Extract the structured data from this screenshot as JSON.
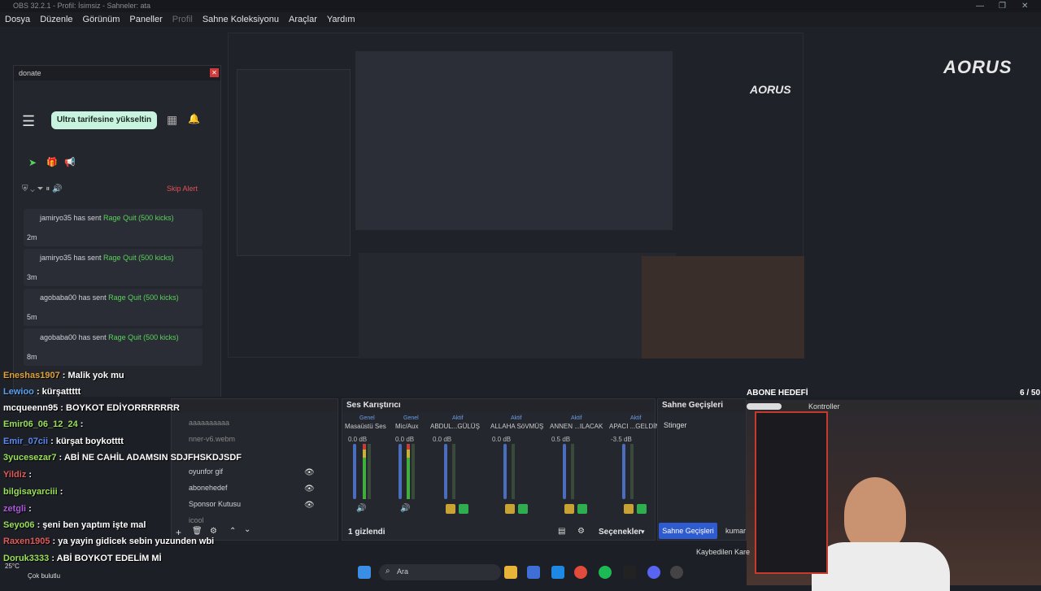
{
  "window": {
    "title": "OBS 32.2.1 - Profil: İsimsiz - Sahneler: ata"
  },
  "menu": [
    "Dosya",
    "Düzenle",
    "Görünüm",
    "Paneller",
    "Profil",
    "Sahne Koleksiyonu",
    "Araçlar",
    "Yardım"
  ],
  "donate": {
    "title": "donate",
    "upgrade": "Ultra tarifesine yükseltin",
    "skip": "Skip Alert",
    "alerts": [
      {
        "user": "jamiryo35",
        "text": " has sent ",
        "gift": "Rage Quit (500 kicks)",
        "ago": "2m"
      },
      {
        "user": "jamiryo35",
        "text": " has sent ",
        "gift": "Rage Quit (500 kicks)",
        "ago": "3m"
      },
      {
        "user": "agobaba00",
        "text": " has sent ",
        "gift": "Rage Quit (500 kicks)",
        "ago": "5m"
      },
      {
        "user": "agobaba00",
        "text": " has sent ",
        "gift": "Rage Quit (500 kicks)",
        "ago": "8m"
      }
    ]
  },
  "chat": [
    {
      "user": "Eneshas1907",
      "msg": " : Malik yok mu",
      "color": "#e0a23a"
    },
    {
      "user": "Lewioo",
      "msg": " : kürşattttt",
      "color": "#5aa0f0"
    },
    {
      "user": "mcqueenn95",
      "msg": " : BOYKOT EDİYORRRRRRR",
      "color": "#ffffff"
    },
    {
      "user": "Emir06_06_12_24",
      "msg": " :",
      "color": "#9adf5a"
    },
    {
      "user": "Emir_07cii",
      "msg": " : kürşat boykotttt",
      "color": "#5a8af0"
    },
    {
      "user": "3yucesezar7",
      "msg": " : ABİ NE CAHİL ADAMSIN SDJFHSKDJSDF",
      "color": "#9adf5a"
    },
    {
      "user": "Yildiz",
      "msg": " :",
      "color": "#e05a5a"
    },
    {
      "user": "bilgisayarciii",
      "msg": " :",
      "color": "#9adf5a"
    },
    {
      "user": "zetgli",
      "msg": " :",
      "color": "#b05ae0"
    },
    {
      "user": "Seyo06",
      "msg": " : şeni ben yaptım işte mal",
      "color": "#9adf5a"
    },
    {
      "user": "Raxen1905",
      "msg": " : ya yayin gidicek sebin yuzunden wbi",
      "color": "#e05a5a"
    },
    {
      "user": "Doruk3333",
      "msg": " : ABİ BOYKOT EDELİM Mİ",
      "color": "#9adf5a"
    }
  ],
  "sources": {
    "items": [
      "oyunfor gif",
      "abonehedef",
      "Sponsor Kutusu",
      "icool"
    ],
    "partial": [
      "aaaaaaaaaa",
      "nner-v6.webm"
    ]
  },
  "mixer": {
    "title": "Ses Karıştırıcı",
    "channels": [
      {
        "tag": "Genel",
        "name": "Masaüstü Ses",
        "db": "0.0 dB"
      },
      {
        "tag": "Genel",
        "name": "Mic/Aux",
        "db": "0.0 dB"
      },
      {
        "tag": "Aktif",
        "name": "ABDUL...GÜLÜŞ",
        "db": "0.0 dB"
      },
      {
        "tag": "Aktif",
        "name": "ALLAHA SöVMÜŞ",
        "db": "0.0 dB"
      },
      {
        "tag": "Aktif",
        "name": "ANNEN ...ILACAK",
        "db": "0.5 dB"
      },
      {
        "tag": "Aktif",
        "name": "APACI ...GELDİN",
        "db": "-3.5 dB"
      }
    ],
    "hidden": "1 gizlendi",
    "options": "Seçenekler"
  },
  "transitions": {
    "title": "Sahne Geçişleri",
    "value": "Stinger",
    "button": "Sahne Geçişleri",
    "partial": "kumar"
  },
  "overlay": {
    "goal_title": "ABONE HEDEFİ",
    "goal_count": "6 / 50",
    "goal_progress": 0.12,
    "controls": "Kontroller",
    "brand": "AORUS",
    "lost": "Kaybedilen Kare"
  },
  "taskbar": {
    "search": "Ara",
    "weather": "25°C",
    "weather_desc": "Çok bulutlu"
  }
}
